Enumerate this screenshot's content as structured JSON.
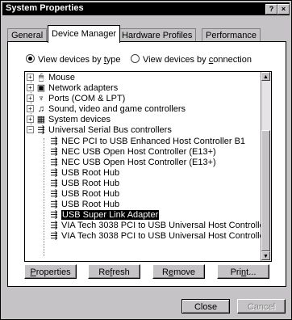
{
  "window": {
    "title": "System Properties",
    "help_glyph": "?",
    "close_glyph": "×"
  },
  "tabs": [
    {
      "label": "General",
      "active": false
    },
    {
      "label": "Device Manager",
      "active": true
    },
    {
      "label": "Hardware Profiles",
      "active": false
    },
    {
      "label": "Performance",
      "active": false
    }
  ],
  "view_options": {
    "by_type": {
      "prefix": "View devices by ",
      "key": "t",
      "suffix": "ype",
      "selected": true
    },
    "by_connection": {
      "prefix": "View devices by ",
      "key": "c",
      "suffix": "onnection",
      "selected": false
    }
  },
  "tree": {
    "items": [
      {
        "label": "Mouse",
        "icon": "mouse-icon",
        "glyph": "🖱",
        "expander": "+",
        "level": 0
      },
      {
        "label": "Network adapters",
        "icon": "network-adapter-icon",
        "glyph": "▣",
        "expander": "+",
        "level": 0
      },
      {
        "label": "Ports (COM & LPT)",
        "icon": "port-icon",
        "glyph": "♆",
        "expander": "+",
        "level": 0
      },
      {
        "label": "Sound, video and game controllers",
        "icon": "sound-icon",
        "glyph": "♫",
        "expander": "+",
        "level": 0
      },
      {
        "label": "System devices",
        "icon": "system-device-icon",
        "glyph": "▦",
        "expander": "+",
        "level": 0
      },
      {
        "label": "Universal Serial Bus controllers",
        "icon": "usb-icon",
        "glyph": "⇶",
        "expander": "−",
        "level": 0
      },
      {
        "label": "NEC PCI to USB Enhanced Host Controller B1",
        "icon": "usb-device-icon",
        "glyph": "⇶",
        "level": 1
      },
      {
        "label": "NEC USB Open Host Controller (E13+)",
        "icon": "usb-device-icon",
        "glyph": "⇶",
        "level": 1
      },
      {
        "label": "NEC USB Open Host Controller (E13+)",
        "icon": "usb-device-icon",
        "glyph": "⇶",
        "level": 1
      },
      {
        "label": "USB Root Hub",
        "icon": "usb-device-icon",
        "glyph": "⇶",
        "level": 1
      },
      {
        "label": "USB Root Hub",
        "icon": "usb-device-icon",
        "glyph": "⇶",
        "level": 1
      },
      {
        "label": "USB Root Hub",
        "icon": "usb-device-icon",
        "glyph": "⇶",
        "level": 1
      },
      {
        "label": "USB Root Hub",
        "icon": "usb-device-icon",
        "glyph": "⇶",
        "level": 1
      },
      {
        "label": "USB Super Link Adapter",
        "icon": "usb-device-icon",
        "glyph": "⇶",
        "level": 1,
        "selected": true
      },
      {
        "label": "VIA Tech 3038 PCI to USB Universal Host Controller",
        "icon": "usb-device-icon",
        "glyph": "⇶",
        "level": 1
      },
      {
        "label": "VIA Tech 3038 PCI to USB Universal Host Controller",
        "icon": "usb-device-icon",
        "glyph": "⇶",
        "level": 1
      }
    ]
  },
  "buttons": {
    "properties": {
      "key": "P",
      "rest": "roperties"
    },
    "refresh": {
      "pre": "Re",
      "key": "f",
      "rest": "resh"
    },
    "remove": {
      "pre": "R",
      "key": "e",
      "rest": "move"
    },
    "print": {
      "pre": "Pri",
      "key": "n",
      "rest": "t..."
    },
    "close": "Close",
    "cancel": "Cancel"
  }
}
